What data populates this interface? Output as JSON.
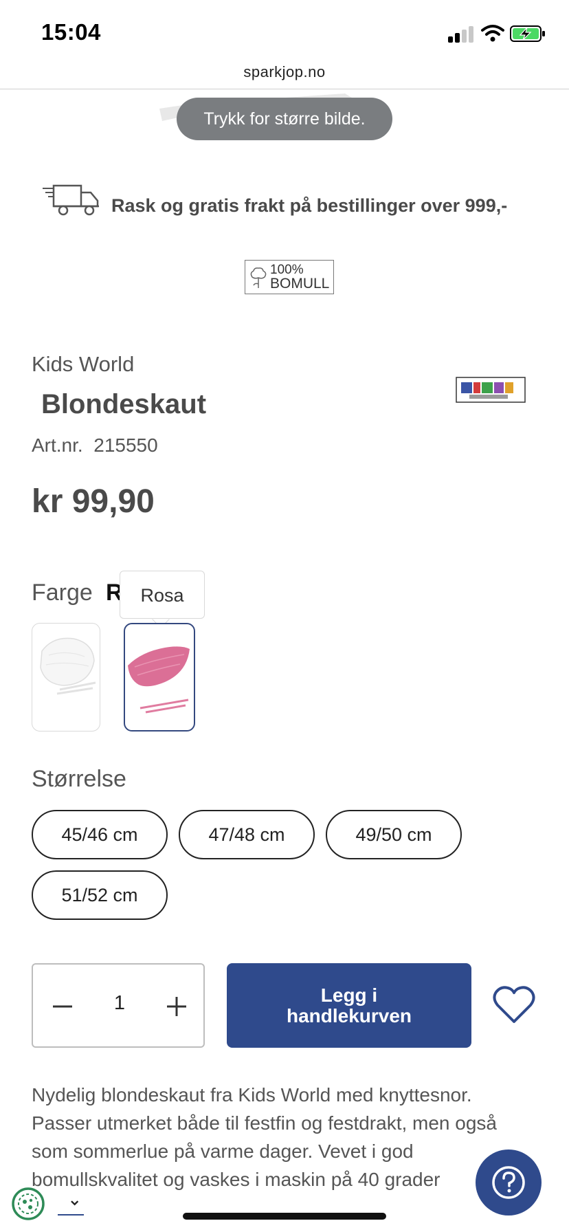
{
  "status_bar": {
    "time": "15:04"
  },
  "browser": {
    "url": "sparkjop.no"
  },
  "toast": {
    "text": "Trykk for større bilde."
  },
  "shipping": {
    "text": "Rask og gratis frakt på bestillinger over 999,-"
  },
  "badge": {
    "line1": "100%",
    "line2": "BOMULL"
  },
  "product": {
    "brand": "Kids World",
    "name": "Blondeskaut",
    "art_label": "Art.nr.",
    "art_number": "215550",
    "price": "kr 99,90"
  },
  "color": {
    "label": "Farge",
    "selected_initial": "R",
    "tooltip": "Rosa",
    "options": [
      "white",
      "pink"
    ],
    "selected_index": 1
  },
  "size": {
    "label": "Størrelse",
    "options": [
      "45/46 cm",
      "47/48 cm",
      "49/50 cm",
      "51/52 cm"
    ]
  },
  "quantity": {
    "value": "1"
  },
  "cart": {
    "line1": "Legg i",
    "line2": "handlekurven"
  },
  "description": {
    "lines": [
      "Nydelig blondeskaut fra Kids World med knyttesnor.",
      "Passer utmerket både til festfin og festdrakt, men også",
      "som sommerlue på varme dager. Vevet i god",
      "bomullskvalitet og vaskes i maskin på 40 grader"
    ]
  },
  "colors": {
    "accent": "#2f4a8c",
    "toast_bg": "#7a7d80",
    "text": "#4a4a4a",
    "swatch_pink": "#d8638e"
  },
  "icons": [
    "signal-icon",
    "wifi-icon",
    "battery-icon",
    "truck-icon",
    "cotton-icon",
    "minus-icon",
    "plus-icon",
    "heart-icon",
    "chevron-down-icon",
    "question-icon",
    "cookie-icon"
  ]
}
